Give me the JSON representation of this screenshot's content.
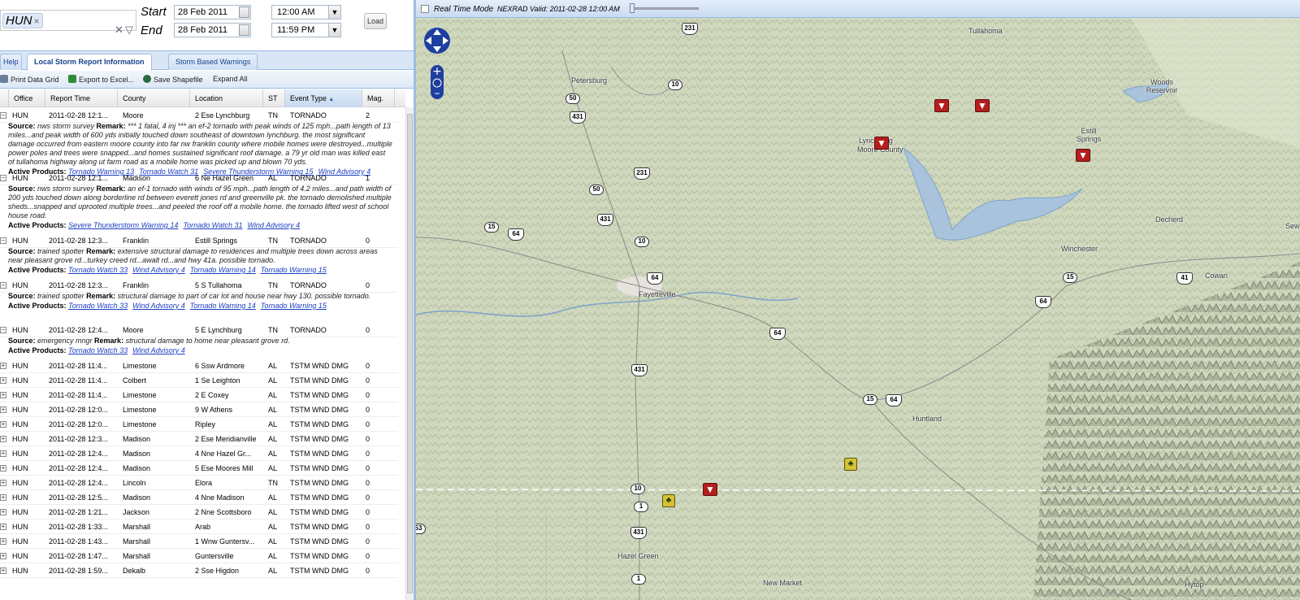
{
  "filter": {
    "tag": "HUN",
    "remove": "×",
    "clear": "✕",
    "dropdown": "▽"
  },
  "start": {
    "label": "Start",
    "date": "28 Feb 2011",
    "time": "12:00 AM"
  },
  "end": {
    "label": "End",
    "date": "28 Feb 2011",
    "time": "11:59 PM"
  },
  "load_label": "Load",
  "tabs": [
    "Help",
    "Local Storm Report Information",
    "Storm Based Warnings"
  ],
  "toolbar": {
    "print": "Print Data Grid",
    "export": "Export to Excel...",
    "shapefile": "Save Shapefile",
    "expand": "Expand All"
  },
  "columns": [
    "Office",
    "Report Time",
    "County",
    "Location",
    "ST",
    "Event Type",
    "Mag."
  ],
  "sort_indicator": "▲",
  "expanded_rows": [
    {
      "office": "HUN",
      "time": "2011-02-28 12:1...",
      "county": "Moore",
      "location": "2 Ese Lynchburg",
      "st": "TN",
      "event": "TORNADO",
      "mag": "2",
      "source": "nws storm survey",
      "remark": "*** 1 fatal, 4 inj *** an ef-2 tornado with peak winds of 125 mph...path length of 13 miles...and peak width of 600 yds initially touched down southeast of downtown lynchburg. the most significant damage occurred from eastern moore county into far nw franklin county where mobile homes were destroyed...multiple power poles and trees were snapped...and homes sustained significant roof damage. a 79 yr old man was killed east of tullahoma highway along ut farm road as a mobile home was picked up and blown 70 yds.",
      "products": [
        "Tornado Warning 13",
        "Tornado Watch 31",
        "Severe Thunderstorm Warning 15",
        "Wind Advisory 4"
      ]
    },
    {
      "office": "HUN",
      "time": "2011-02-28 12:1...",
      "county": "Madison",
      "location": "6 Ne Hazel Green",
      "st": "AL",
      "event": "TORNADO",
      "mag": "1",
      "source": "nws storm survey",
      "remark": "an ef-1 tornado with winds of 95 mph...path length of 4.2 miles...and path width of 200 yds touched down along borderline rd between everett jones rd and greenville pk. the tornado demolished multiple sheds...snapped and uprooted multiple trees...and peeled the roof off a mobile home. the tornado lifted west of school house road.",
      "products": [
        "Severe Thunderstorm Warning 14",
        "Tornado Watch 31",
        "Wind Advisory 4"
      ]
    },
    {
      "office": "HUN",
      "time": "2011-02-28 12:3...",
      "county": "Franklin",
      "location": "Estill Springs",
      "st": "TN",
      "event": "TORNADO",
      "mag": "0",
      "source": "trained spotter",
      "remark": "extensive structural damage to residences and multiple trees down across areas near pleasant grove rd...turkey creed rd...awalt rd...and hwy 41a. possible tornado.",
      "products": [
        "Tornado Watch 33",
        "Wind Advisory 4",
        "Tornado Warning 14",
        "Tornado Warning 15"
      ]
    },
    {
      "office": "HUN",
      "time": "2011-02-28 12:3...",
      "county": "Franklin",
      "location": "5 S Tullahoma",
      "st": "TN",
      "event": "TORNADO",
      "mag": "0",
      "source": "trained spotter",
      "remark": "structural damage to part of car lot and house near hwy 130. possible tornado.",
      "products": [
        "Tornado Watch 33",
        "Wind Advisory 4",
        "Tornado Warning 14",
        "Tornado Warning 15"
      ]
    },
    {
      "office": "HUN",
      "time": "2011-02-28 12:4...",
      "county": "Moore",
      "location": "5 E Lynchburg",
      "st": "TN",
      "event": "TORNADO",
      "mag": "0",
      "source": "emergency mngr",
      "remark": "structural damage to home near pleasant grove rd.",
      "products": [
        "Tornado Watch 33",
        "Wind Advisory 4"
      ]
    }
  ],
  "labels": {
    "source": "Source:",
    "remark": "Remark:",
    "active": "Active Products:"
  },
  "collapsed_rows": [
    [
      "HUN",
      "2011-02-28 11:4...",
      "Limestone",
      "6 Ssw Ardmore",
      "AL",
      "TSTM WND DMG",
      "0"
    ],
    [
      "HUN",
      "2011-02-28 11:4...",
      "Colbert",
      "1 Se Leighton",
      "AL",
      "TSTM WND DMG",
      "0"
    ],
    [
      "HUN",
      "2011-02-28 11:4...",
      "Limestone",
      "2 E Coxey",
      "AL",
      "TSTM WND DMG",
      "0"
    ],
    [
      "HUN",
      "2011-02-28 12:0...",
      "Limestone",
      "9 W Athens",
      "AL",
      "TSTM WND DMG",
      "0"
    ],
    [
      "HUN",
      "2011-02-28 12:0...",
      "Limestone",
      "Ripley",
      "AL",
      "TSTM WND DMG",
      "0"
    ],
    [
      "HUN",
      "2011-02-28 12:3...",
      "Madison",
      "2 Ese Meridianville",
      "AL",
      "TSTM WND DMG",
      "0"
    ],
    [
      "HUN",
      "2011-02-28 12:4...",
      "Madison",
      "4 Nne Hazel Gr...",
      "AL",
      "TSTM WND DMG",
      "0"
    ],
    [
      "HUN",
      "2011-02-28 12:4...",
      "Madison",
      "5 Ese Moores Mill",
      "AL",
      "TSTM WND DMG",
      "0"
    ],
    [
      "HUN",
      "2011-02-28 12:4...",
      "Lincoln",
      "Elora",
      "TN",
      "TSTM WND DMG",
      "0"
    ],
    [
      "HUN",
      "2011-02-28 12:5...",
      "Madison",
      "4 Nne Madison",
      "AL",
      "TSTM WND DMG",
      "0"
    ],
    [
      "HUN",
      "2011-02-28 1:21...",
      "Jackson",
      "2 Nne Scottsboro",
      "AL",
      "TSTM WND DMG",
      "0"
    ],
    [
      "HUN",
      "2011-02-28 1:33...",
      "Marshall",
      "Arab",
      "AL",
      "TSTM WND DMG",
      "0"
    ],
    [
      "HUN",
      "2011-02-28 1:43...",
      "Marshall",
      "1 Wnw Guntersv...",
      "AL",
      "TSTM WND DMG",
      "0"
    ],
    [
      "HUN",
      "2011-02-28 1:47...",
      "Marshall",
      "Guntersville",
      "AL",
      "TSTM WND DMG",
      "0"
    ],
    [
      "HUN",
      "2011-02-28 1:59...",
      "Dekalb",
      "2 Sse Higdon",
      "AL",
      "TSTM WND DMG",
      "0"
    ]
  ],
  "mapbar": {
    "realtime": "Real Time Mode",
    "nexrad": "NEXRAD Valid: 2011-02-28 12:00 AM"
  },
  "places": [
    "Tullahoma",
    "Petersburg",
    "Woods Reservoir",
    "Lynchburg",
    "Moore County",
    "Estill Springs",
    "Decherd",
    "Winchester",
    "Cowan",
    "Fayetteville",
    "Huntland",
    "Hazel Green",
    "New Market",
    "Hytop",
    "Sew"
  ],
  "route_labels": [
    "231",
    "10",
    "50",
    "431",
    "231",
    "50",
    "431",
    "15",
    "64",
    "10",
    "64",
    "15",
    "41",
    "64",
    "64",
    "431",
    "15",
    "64",
    "10",
    "1",
    "431",
    "1",
    "53"
  ],
  "icons": {
    "tornado": "tornado-icon",
    "wind": "wind-damage-icon"
  }
}
